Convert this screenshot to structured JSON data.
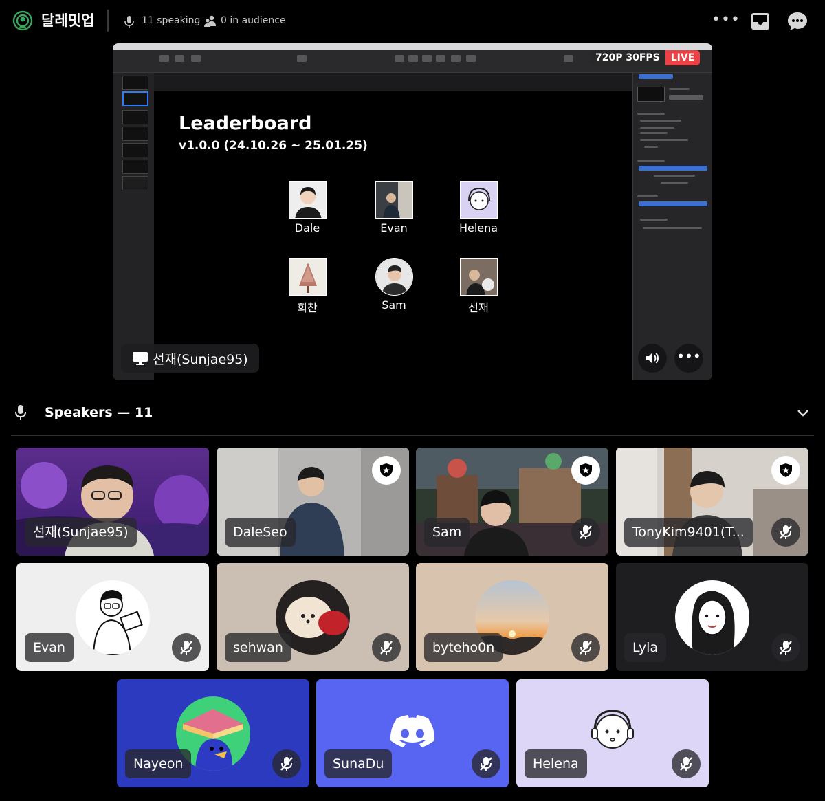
{
  "header": {
    "title": "달레밋업",
    "speaking": "11 speaking",
    "audience": "0 in audience",
    "more_label": "•••"
  },
  "stream": {
    "quality": "720P 30FPS",
    "live": "LIVE",
    "streamer": "선재(Sunjae95)",
    "more_label": "•••",
    "slide": {
      "title": "Leaderboard",
      "version": "v1.0.0 (24.10.26 ~ 25.01.25)",
      "people": [
        "Dale",
        "Evan",
        "Helena",
        "희찬",
        "Sam",
        "선재"
      ]
    }
  },
  "speakers": {
    "title": "Speakers — 11",
    "tiles": [
      {
        "name": "선재(Sunjae95)",
        "speaking": true,
        "moderator": false,
        "muted": false
      },
      {
        "name": "DaleSeo",
        "speaking": false,
        "moderator": true,
        "muted": false
      },
      {
        "name": "Sam",
        "speaking": false,
        "moderator": true,
        "muted": true
      },
      {
        "name": "TonyKim9401(T...",
        "speaking": false,
        "moderator": true,
        "muted": true
      },
      {
        "name": "Evan",
        "speaking": false,
        "moderator": false,
        "muted": true
      },
      {
        "name": "sehwan",
        "speaking": false,
        "moderator": false,
        "muted": true
      },
      {
        "name": "byteho0n",
        "speaking": false,
        "moderator": false,
        "muted": true
      },
      {
        "name": "Lyla",
        "speaking": false,
        "moderator": false,
        "muted": true
      },
      {
        "name": "Nayeon",
        "speaking": false,
        "moderator": false,
        "muted": true
      },
      {
        "name": "SunaDu",
        "speaking": false,
        "moderator": false,
        "muted": true
      },
      {
        "name": "Helena",
        "speaking": false,
        "moderator": false,
        "muted": true
      }
    ]
  },
  "colors": {
    "live": "#ed4245",
    "speaking_ring": "#3ba55d",
    "blurple": "#5865f2",
    "stage_green": "#3ba55d"
  },
  "icons": [
    "stage-icon",
    "mic-icon",
    "audience-icon",
    "inbox-icon",
    "chat-icon",
    "screen-share-icon",
    "volume-icon",
    "chevron-down-icon",
    "mic-muted-icon",
    "moderator-shield-icon",
    "discord-logo-icon"
  ]
}
